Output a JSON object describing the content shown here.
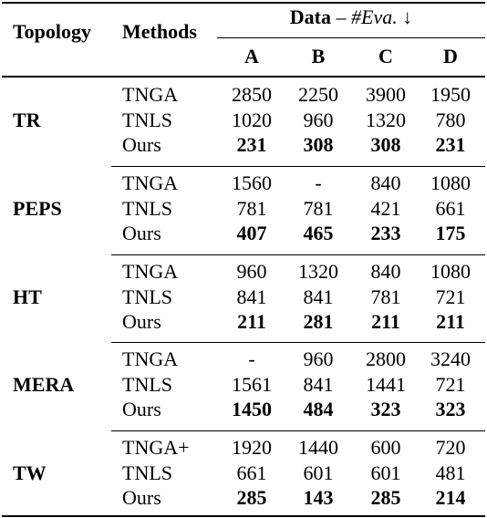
{
  "header": {
    "topology": "Topology",
    "methods": "Methods",
    "data_prefix": "Data",
    "data_dash": " – ",
    "data_metric": "#Eva.",
    "data_arrow": " ↓",
    "columns": [
      "A",
      "B",
      "C",
      "D"
    ]
  },
  "groups": [
    {
      "topology": "TR",
      "rows": [
        {
          "method": "TNGA",
          "values": [
            "2850",
            "2250",
            "3900",
            "1950"
          ],
          "bold": false
        },
        {
          "method": "TNLS",
          "values": [
            "1020",
            "960",
            "1320",
            "780"
          ],
          "bold": false
        },
        {
          "method": "Ours",
          "values": [
            "231",
            "308",
            "308",
            "231"
          ],
          "bold": true
        }
      ]
    },
    {
      "topology": "PEPS",
      "rows": [
        {
          "method": "TNGA",
          "values": [
            "1560",
            "-",
            "840",
            "1080"
          ],
          "bold": false
        },
        {
          "method": "TNLS",
          "values": [
            "781",
            "781",
            "421",
            "661"
          ],
          "bold": false
        },
        {
          "method": "Ours",
          "values": [
            "407",
            "465",
            "233",
            "175"
          ],
          "bold": true
        }
      ]
    },
    {
      "topology": "HT",
      "rows": [
        {
          "method": "TNGA",
          "values": [
            "960",
            "1320",
            "840",
            "1080"
          ],
          "bold": false
        },
        {
          "method": "TNLS",
          "values": [
            "841",
            "841",
            "781",
            "721"
          ],
          "bold": false
        },
        {
          "method": "Ours",
          "values": [
            "211",
            "281",
            "211",
            "211"
          ],
          "bold": true
        }
      ]
    },
    {
      "topology": "MERA",
      "rows": [
        {
          "method": "TNGA",
          "values": [
            "-",
            "960",
            "2800",
            "3240"
          ],
          "bold": false
        },
        {
          "method": "TNLS",
          "values": [
            "1561",
            "841",
            "1441",
            "721"
          ],
          "bold": false
        },
        {
          "method": "Ours",
          "values": [
            "1450",
            "484",
            "323",
            "323"
          ],
          "bold": true
        }
      ]
    },
    {
      "topology": "TW",
      "rows": [
        {
          "method": "TNGA+",
          "values": [
            "1920",
            "1440",
            "600",
            "720"
          ],
          "bold": false
        },
        {
          "method": "TNLS",
          "values": [
            "661",
            "601",
            "601",
            "481"
          ],
          "bold": false
        },
        {
          "method": "Ours",
          "values": [
            "285",
            "143",
            "285",
            "214"
          ],
          "bold": true
        }
      ]
    }
  ]
}
